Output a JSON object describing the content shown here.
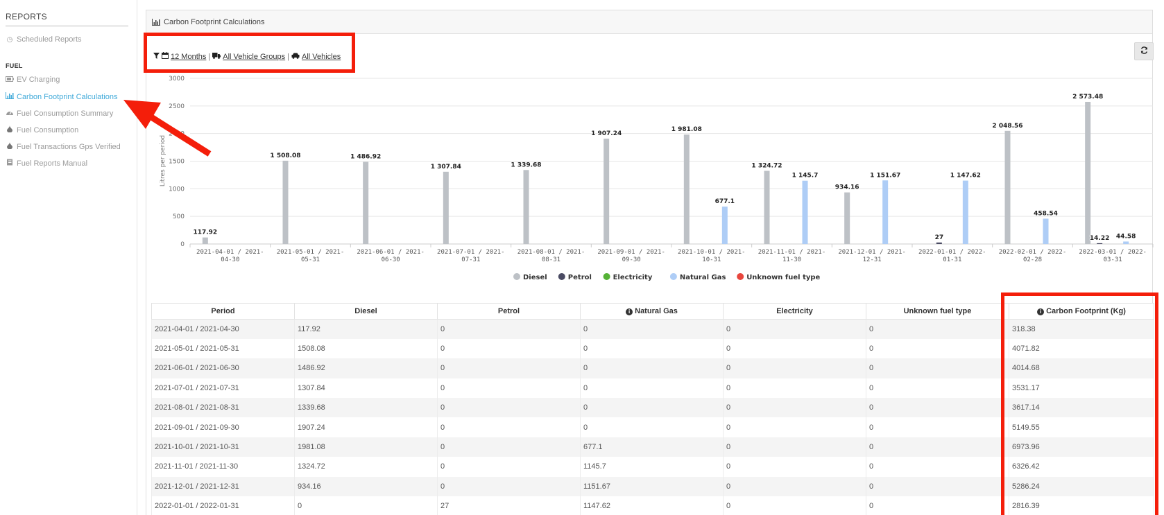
{
  "sidebar": {
    "heading": "REPORTS",
    "scheduled": "Scheduled Reports",
    "section": "FUEL",
    "items": [
      {
        "label": "EV Charging",
        "icon": "battery-icon"
      },
      {
        "label": "Carbon Footprint Calculations",
        "icon": "bar-chart-icon"
      },
      {
        "label": "Fuel Consumption Summary",
        "icon": "dashboard-icon"
      },
      {
        "label": "Fuel Consumption",
        "icon": "drop-icon"
      },
      {
        "label": "Fuel Transactions Gps Verified",
        "icon": "drop-icon"
      },
      {
        "label": "Fuel Reports Manual",
        "icon": "book-icon"
      }
    ]
  },
  "panel": {
    "title": "Carbon Footprint Calculations"
  },
  "filters": {
    "period": "12 Months",
    "groups": "All Vehicle Groups",
    "vehicles": "All Vehicles",
    "separator": "|"
  },
  "colors": {
    "diesel": "#bdc1c6",
    "petrol": "#4a4b63",
    "electricity": "#55b236",
    "natural_gas": "#aecdf6",
    "unknown": "#e8463d",
    "accent": "#3fa9d9",
    "annotation": "#f41e0a"
  },
  "chart_data": {
    "type": "bar",
    "ylabel": "Litres per period",
    "ylim": [
      0,
      3000
    ],
    "yticks": [
      "0",
      "500",
      "1000",
      "1500",
      "2000",
      "2500",
      "3000"
    ],
    "categories": [
      [
        "2021-04-01 / 2021-",
        "04-30"
      ],
      [
        "2021-05-01 / 2021-",
        "05-31"
      ],
      [
        "2021-06-01 / 2021-",
        "06-30"
      ],
      [
        "2021-07-01 / 2021-",
        "07-31"
      ],
      [
        "2021-08-01 / 2021-",
        "08-31"
      ],
      [
        "2021-09-01 / 2021-",
        "09-30"
      ],
      [
        "2021-10-01 / 2021-",
        "10-31"
      ],
      [
        "2021-11-01 / 2021-",
        "11-30"
      ],
      [
        "2021-12-01 / 2021-",
        "12-31"
      ],
      [
        "2022-01-01 / 2022-",
        "01-31"
      ],
      [
        "2022-02-01 / 2022-",
        "02-28"
      ],
      [
        "2022-03-01 / 2022-",
        "03-31"
      ]
    ],
    "series": [
      {
        "name": "Diesel",
        "color": "#bdc1c6",
        "values": [
          117.92,
          1508.08,
          1486.92,
          1307.84,
          1339.68,
          1907.24,
          1981.08,
          1324.72,
          934.16,
          0,
          2048.56,
          2573.48
        ],
        "labels": [
          "117.92",
          "1 508.08",
          "1 486.92",
          "1 307.84",
          "1 339.68",
          "1 907.24",
          "1 981.08",
          "1 324.72",
          "934.16",
          "",
          "2 048.56",
          "2 573.48"
        ]
      },
      {
        "name": "Petrol",
        "color": "#4a4b63",
        "values": [
          0,
          0,
          0,
          0,
          0,
          0,
          0,
          0,
          0,
          27,
          0,
          14.22
        ],
        "labels": [
          "",
          "",
          "",
          "",
          "",
          "",
          "",
          "",
          "",
          "27",
          "",
          "14.22"
        ]
      },
      {
        "name": "Electricity",
        "color": "#55b236",
        "values": [
          0,
          0,
          0,
          0,
          0,
          0,
          0,
          0,
          0,
          0,
          0,
          0
        ],
        "labels": [
          "",
          "",
          "",
          "",
          "",
          "",
          "",
          "",
          "",
          "",
          "",
          ""
        ]
      },
      {
        "name": "Natural Gas",
        "color": "#aecdf6",
        "values": [
          0,
          0,
          0,
          0,
          0,
          0,
          677.1,
          1145.7,
          1151.67,
          1147.62,
          458.54,
          44.58
        ],
        "labels": [
          "",
          "",
          "",
          "",
          "",
          "",
          "677.1",
          "1 145.7",
          "1 151.67",
          "1 147.62",
          "458.54",
          "44.58"
        ]
      },
      {
        "name": "Unknown fuel type",
        "color": "#e8463d",
        "values": [
          0,
          0,
          0,
          0,
          0,
          0,
          0,
          0,
          0,
          0,
          0,
          0
        ],
        "labels": [
          "",
          "",
          "",
          "",
          "",
          "",
          "",
          "",
          "",
          "",
          "",
          ""
        ]
      }
    ],
    "legend": "bottom-center",
    "grid": true
  },
  "table": {
    "headers": [
      "Period",
      "Diesel",
      "Petrol",
      "Natural Gas",
      "Electricity",
      "Unknown fuel type",
      "Carbon Footprint (Kg)"
    ],
    "rows": [
      [
        "2021-04-01 / 2021-04-30",
        "117.92",
        "0",
        "0",
        "0",
        "0",
        "318.38"
      ],
      [
        "2021-05-01 / 2021-05-31",
        "1508.08",
        "0",
        "0",
        "0",
        "0",
        "4071.82"
      ],
      [
        "2021-06-01 / 2021-06-30",
        "1486.92",
        "0",
        "0",
        "0",
        "0",
        "4014.68"
      ],
      [
        "2021-07-01 / 2021-07-31",
        "1307.84",
        "0",
        "0",
        "0",
        "0",
        "3531.17"
      ],
      [
        "2021-08-01 / 2021-08-31",
        "1339.68",
        "0",
        "0",
        "0",
        "0",
        "3617.14"
      ],
      [
        "2021-09-01 / 2021-09-30",
        "1907.24",
        "0",
        "0",
        "0",
        "0",
        "5149.55"
      ],
      [
        "2021-10-01 / 2021-10-31",
        "1981.08",
        "0",
        "677.1",
        "0",
        "0",
        "6973.96"
      ],
      [
        "2021-11-01 / 2021-11-30",
        "1324.72",
        "0",
        "1145.7",
        "0",
        "0",
        "6326.42"
      ],
      [
        "2021-12-01 / 2021-12-31",
        "934.16",
        "0",
        "1151.67",
        "0",
        "0",
        "5286.24"
      ],
      [
        "2022-01-01 / 2022-01-31",
        "0",
        "27",
        "1147.62",
        "0",
        "0",
        "2816.39"
      ]
    ]
  }
}
